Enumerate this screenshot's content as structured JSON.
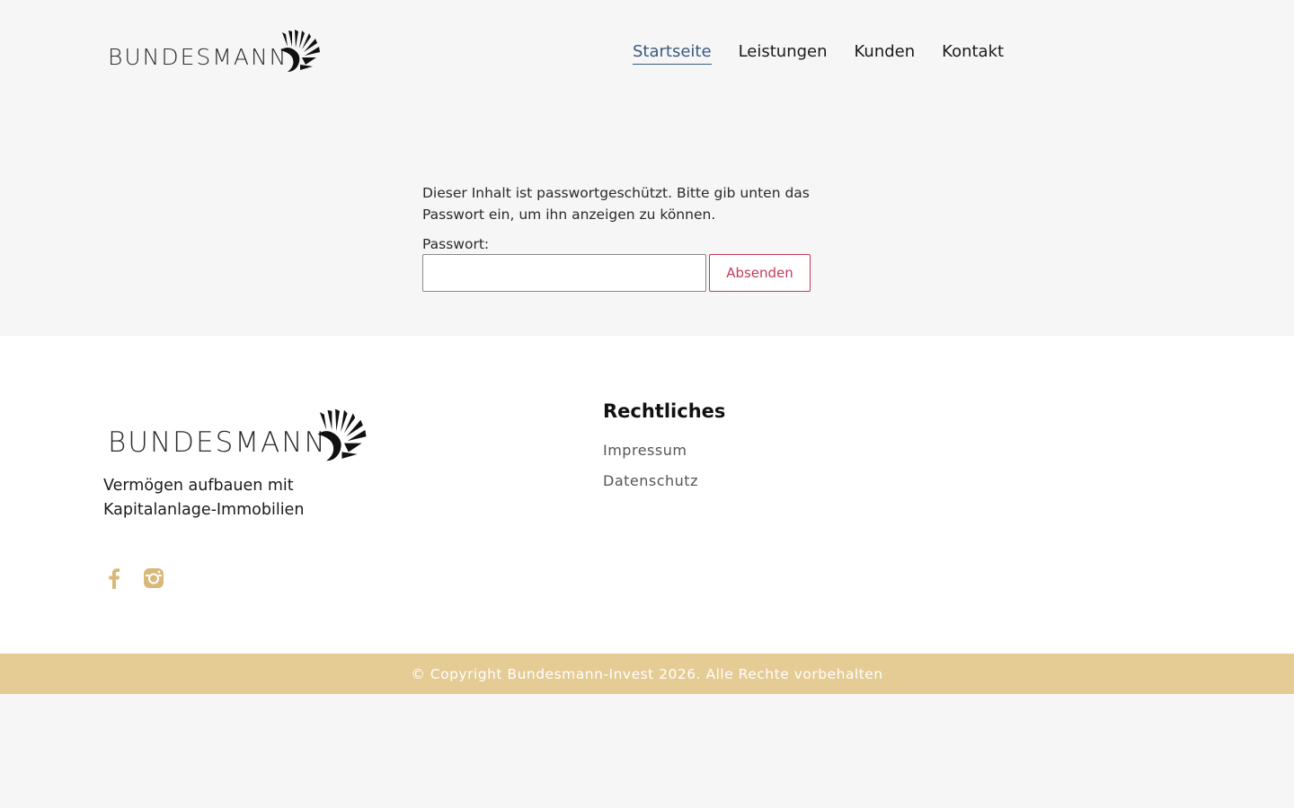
{
  "brand": {
    "name": "BUNDESMANN",
    "logo_icon": "eagle-wing-icon"
  },
  "nav": {
    "items": [
      {
        "label": "Startseite"
      },
      {
        "label": "Leistungen"
      },
      {
        "label": "Kunden"
      },
      {
        "label": "Kontakt"
      }
    ],
    "active": "Startseite"
  },
  "main": {
    "notice": "Dieser Inhalt ist passwortgeschützt. Bitte gib unten das Passwort ein, um ihn anzeigen zu können.",
    "password_label": "Passwort:",
    "password_value": "",
    "submit_label": "Absenden"
  },
  "footer": {
    "tagline": "Vermögen aufbauen mit Kapitalanlage-Immobilien",
    "socials": [
      "facebook-icon",
      "instagram-icon"
    ],
    "legal": {
      "heading": "Rechtliches",
      "links": [
        {
          "label": "Impressum"
        },
        {
          "label": "Datenschutz"
        }
      ]
    },
    "copyright": "© Copyright Bundesmann-Invest 2026. Alle Rechte vorbehalten"
  },
  "colors": {
    "background": "#f6f6f6",
    "accent_link": "#3a5a80",
    "button_accent": "#c23b5a",
    "copyright_bar": "#e5cb94",
    "social_icon": "#d9b97a"
  }
}
